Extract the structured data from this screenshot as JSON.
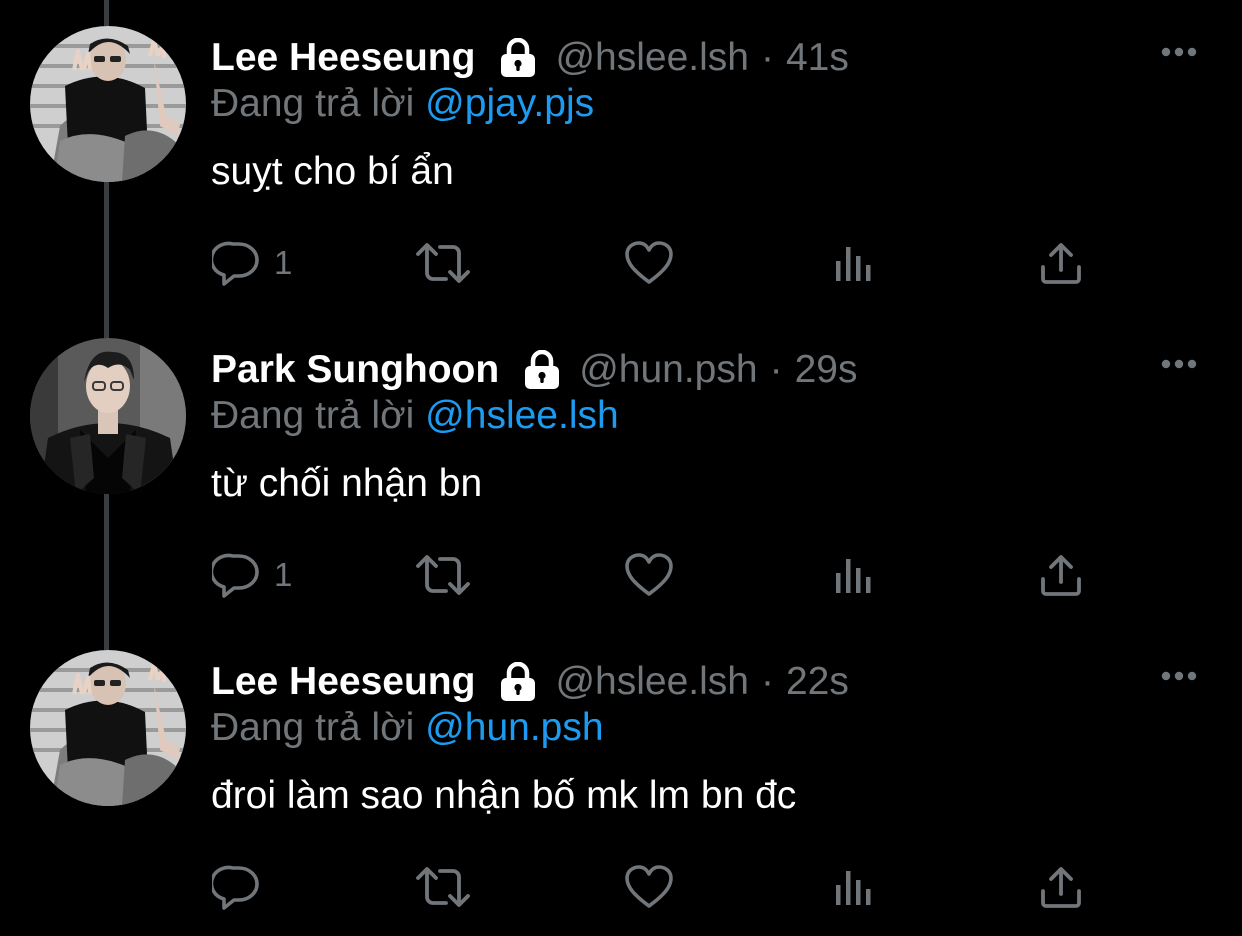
{
  "theme": {
    "background": "#000000",
    "text_primary": "#ffffff",
    "text_secondary": "#71767b",
    "link": "#1d9bf0",
    "thread_line": "#3a3d40"
  },
  "thread": {
    "tweets": [
      {
        "display_name": "Lee Heeseung",
        "handle": "@hslee.lsh",
        "separator": "·",
        "time": "41s",
        "protected_icon": "lock-icon",
        "reply_prefix": "Đang trả lời",
        "reply_to": "@pjay.pjs",
        "text": "suỵt cho bí ẩn",
        "reply_count": "1",
        "avatar": "avatar-photo"
      },
      {
        "display_name": "Park Sunghoon",
        "handle": "@hun.psh",
        "separator": "·",
        "time": "29s",
        "protected_icon": "lock-icon",
        "reply_prefix": "Đang trả lời",
        "reply_to": "@hslee.lsh",
        "text": "từ chối nhận bn",
        "reply_count": "1",
        "avatar": "avatar-photo"
      },
      {
        "display_name": "Lee Heeseung",
        "handle": "@hslee.lsh",
        "separator": "·",
        "time": "22s",
        "protected_icon": "lock-icon",
        "reply_prefix": "Đang trả lời",
        "reply_to": "@hun.psh",
        "text": "đroi làm sao nhận bố mk lm bn đc",
        "reply_count": "",
        "avatar": "avatar-photo"
      }
    ]
  },
  "icons": {
    "reply": "reply-icon",
    "retweet": "retweet-icon",
    "like": "heart-icon",
    "views": "views-icon",
    "share": "share-icon",
    "more": "more-icon"
  }
}
